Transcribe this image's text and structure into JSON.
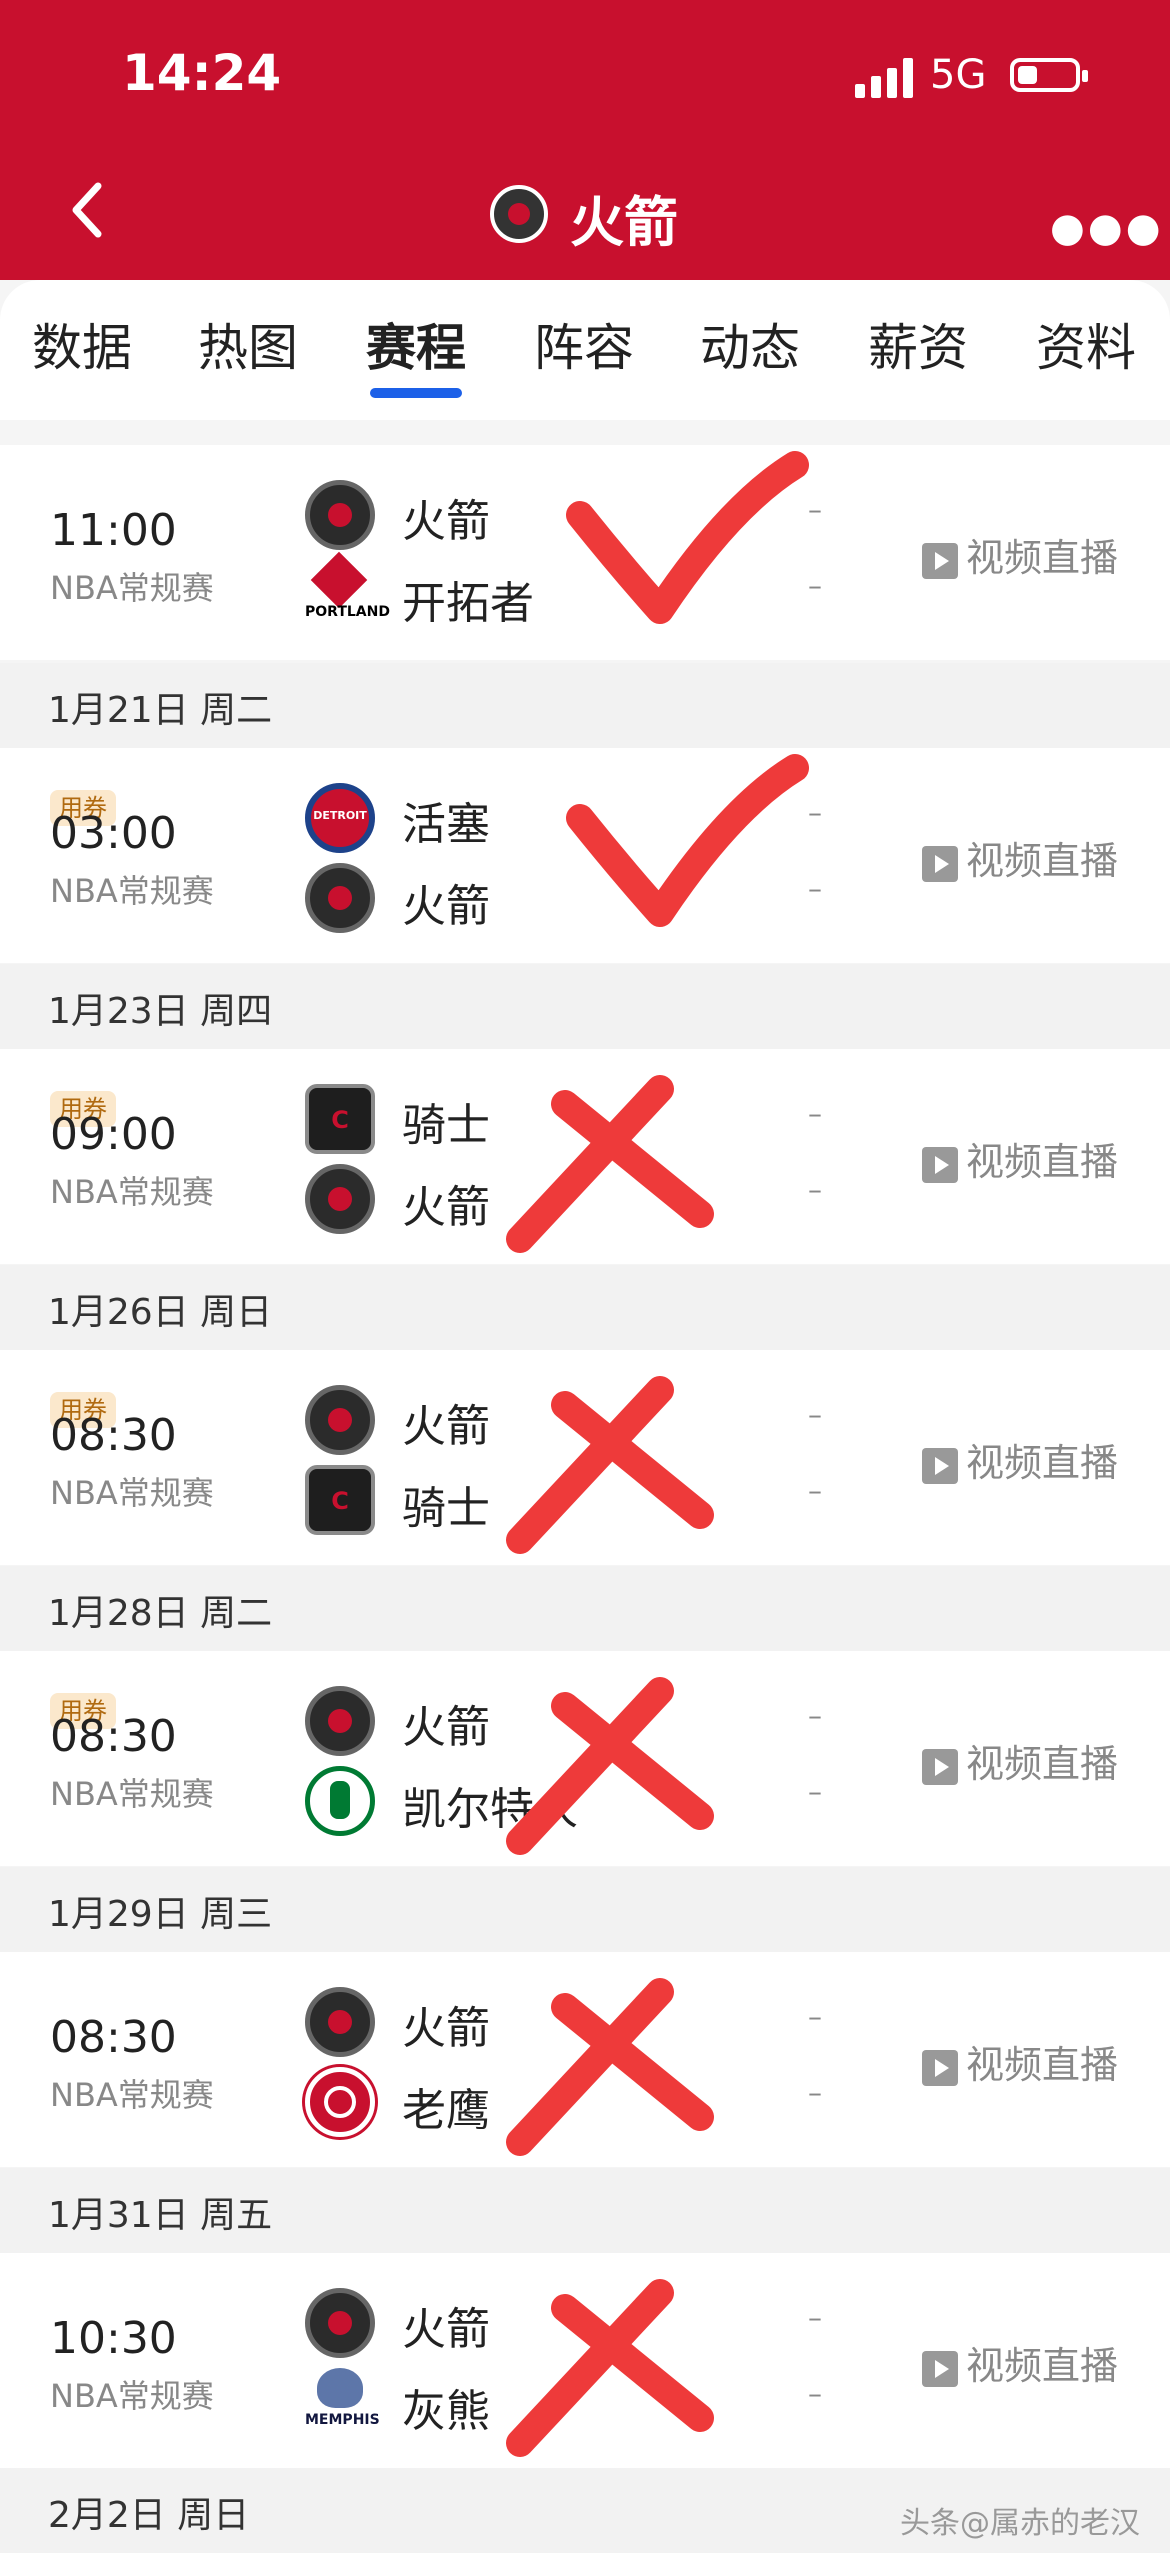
{
  "status_bar": {
    "time": "14:24",
    "network": "5G",
    "battery_level": 0.35
  },
  "header": {
    "title": "火箭"
  },
  "tabs": [
    {
      "label": "数据",
      "active": false
    },
    {
      "label": "热图",
      "active": false
    },
    {
      "label": "赛程",
      "active": true
    },
    {
      "label": "阵容",
      "active": false
    },
    {
      "label": "动态",
      "active": false
    },
    {
      "label": "薪资",
      "active": false
    },
    {
      "label": "资料",
      "active": false
    }
  ],
  "games": [
    {
      "date": "",
      "coupon": "",
      "time": "11:00",
      "league": "NBA常规赛",
      "home": "火箭",
      "home_logo": "rockets-logo",
      "away": "开拓者",
      "away_logo": "blazers-logo",
      "score_home": "–",
      "score_away": "–",
      "video": "视频直播",
      "mark": "check"
    },
    {
      "date": "1月21日 周二",
      "coupon": "用券",
      "time": "03:00",
      "league": "NBA常规赛",
      "home": "活塞",
      "home_logo": "pistons-logo",
      "away": "火箭",
      "away_logo": "rockets-logo",
      "score_home": "–",
      "score_away": "–",
      "video": "视频直播",
      "mark": "check"
    },
    {
      "date": "1月23日 周四",
      "coupon": "用券",
      "time": "09:00",
      "league": "NBA常规赛",
      "home": "骑士",
      "home_logo": "cavaliers-logo",
      "away": "火箭",
      "away_logo": "rockets-logo",
      "score_home": "–",
      "score_away": "–",
      "video": "视频直播",
      "mark": "cross"
    },
    {
      "date": "1月26日 周日",
      "coupon": "用券",
      "time": "08:30",
      "league": "NBA常规赛",
      "home": "火箭",
      "home_logo": "rockets-logo",
      "away": "骑士",
      "away_logo": "cavaliers-logo",
      "score_home": "–",
      "score_away": "–",
      "video": "视频直播",
      "mark": "cross"
    },
    {
      "date": "1月28日 周二",
      "coupon": "用券",
      "time": "08:30",
      "league": "NBA常规赛",
      "home": "火箭",
      "home_logo": "rockets-logo",
      "away": "凯尔特人",
      "away_logo": "celtics-logo",
      "score_home": "–",
      "score_away": "–",
      "video": "视频直播",
      "mark": "cross"
    },
    {
      "date": "1月29日 周三",
      "coupon": "",
      "time": "08:30",
      "league": "NBA常规赛",
      "home": "火箭",
      "home_logo": "rockets-logo",
      "away": "老鹰",
      "away_logo": "hawks-logo",
      "score_home": "–",
      "score_away": "–",
      "video": "视频直播",
      "mark": "cross"
    },
    {
      "date": "1月31日 周五",
      "coupon": "",
      "time": "10:30",
      "league": "NBA常规赛",
      "home": "火箭",
      "home_logo": "rockets-logo",
      "away": "灰熊",
      "away_logo": "grizzlies-logo",
      "score_home": "–",
      "score_away": "–",
      "video": "视频直播",
      "mark": "cross"
    }
  ],
  "next_date": "2月2日 周日",
  "watermark": "头条@属赤的老汉",
  "colors": {
    "brand_red": "#c8102e",
    "tab_indicator": "#1c60e8",
    "mark_red": "#ee3a3a"
  }
}
